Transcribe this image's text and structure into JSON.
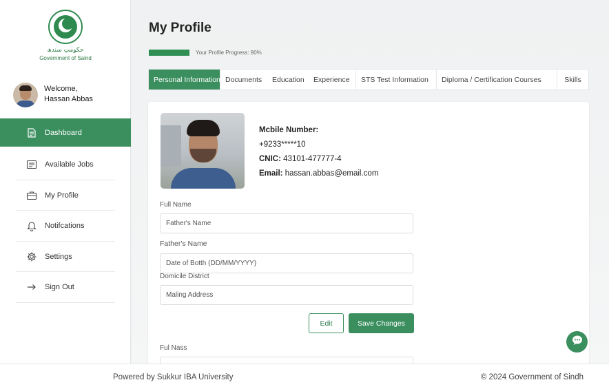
{
  "logo": {
    "urdu": "حکومتِ سندھ",
    "caption": "Government of Saind"
  },
  "user": {
    "greeting": "Welcome,",
    "name": "Hassan Abbas"
  },
  "sidebar": {
    "items": [
      {
        "label": "Dashboard",
        "icon": "dashboard-icon",
        "active": true
      },
      {
        "label": "Available Jobs",
        "icon": "jobs-icon"
      },
      {
        "label": "My Profile",
        "icon": "briefcase-icon"
      },
      {
        "label": "Notifcations",
        "icon": "bell-icon"
      },
      {
        "label": "Settings",
        "icon": "gear-icon"
      },
      {
        "label": "Sign Out",
        "icon": "arrow-right-icon"
      }
    ]
  },
  "page": {
    "title": "My Profile",
    "progress_text": "Your Profile Progress: 80%",
    "progress_value": 0.8
  },
  "tabs": [
    {
      "label": "Personal Information",
      "active": true
    },
    {
      "label": "Documents"
    },
    {
      "label": "Education"
    },
    {
      "label": "Experience"
    },
    {
      "label": "STS Test Information"
    },
    {
      "label": "Diploma / Certification Courses"
    },
    {
      "label": "Skills"
    }
  ],
  "profile": {
    "mobile_label": "Mcbile Number:",
    "mobile_value": "+9233*****10",
    "cnic_label": "CNIC:",
    "cnic_value": "43101-477777-4",
    "email_label": "Email:",
    "email_value": "hassan.abbas@email.com"
  },
  "form": {
    "fields": [
      {
        "label": "Full Name",
        "placeholder": "Father's Name"
      },
      {
        "label": "Father's Name",
        "placeholder": "Date of Botth (DD/MM/YYYY)"
      },
      {
        "label": "Domicile District",
        "placeholder": "Maling Address"
      },
      {
        "label": "Ful Nass",
        "placeholder": ""
      }
    ],
    "edit_label": "Edit",
    "save_label": "Save Changes"
  },
  "footer": {
    "left": "Powered by Sukkur IBA University",
    "right": "© 2024 Government of Sindh"
  },
  "colors": {
    "accent": "#3b8f5f",
    "progress": "#2f8f52"
  }
}
